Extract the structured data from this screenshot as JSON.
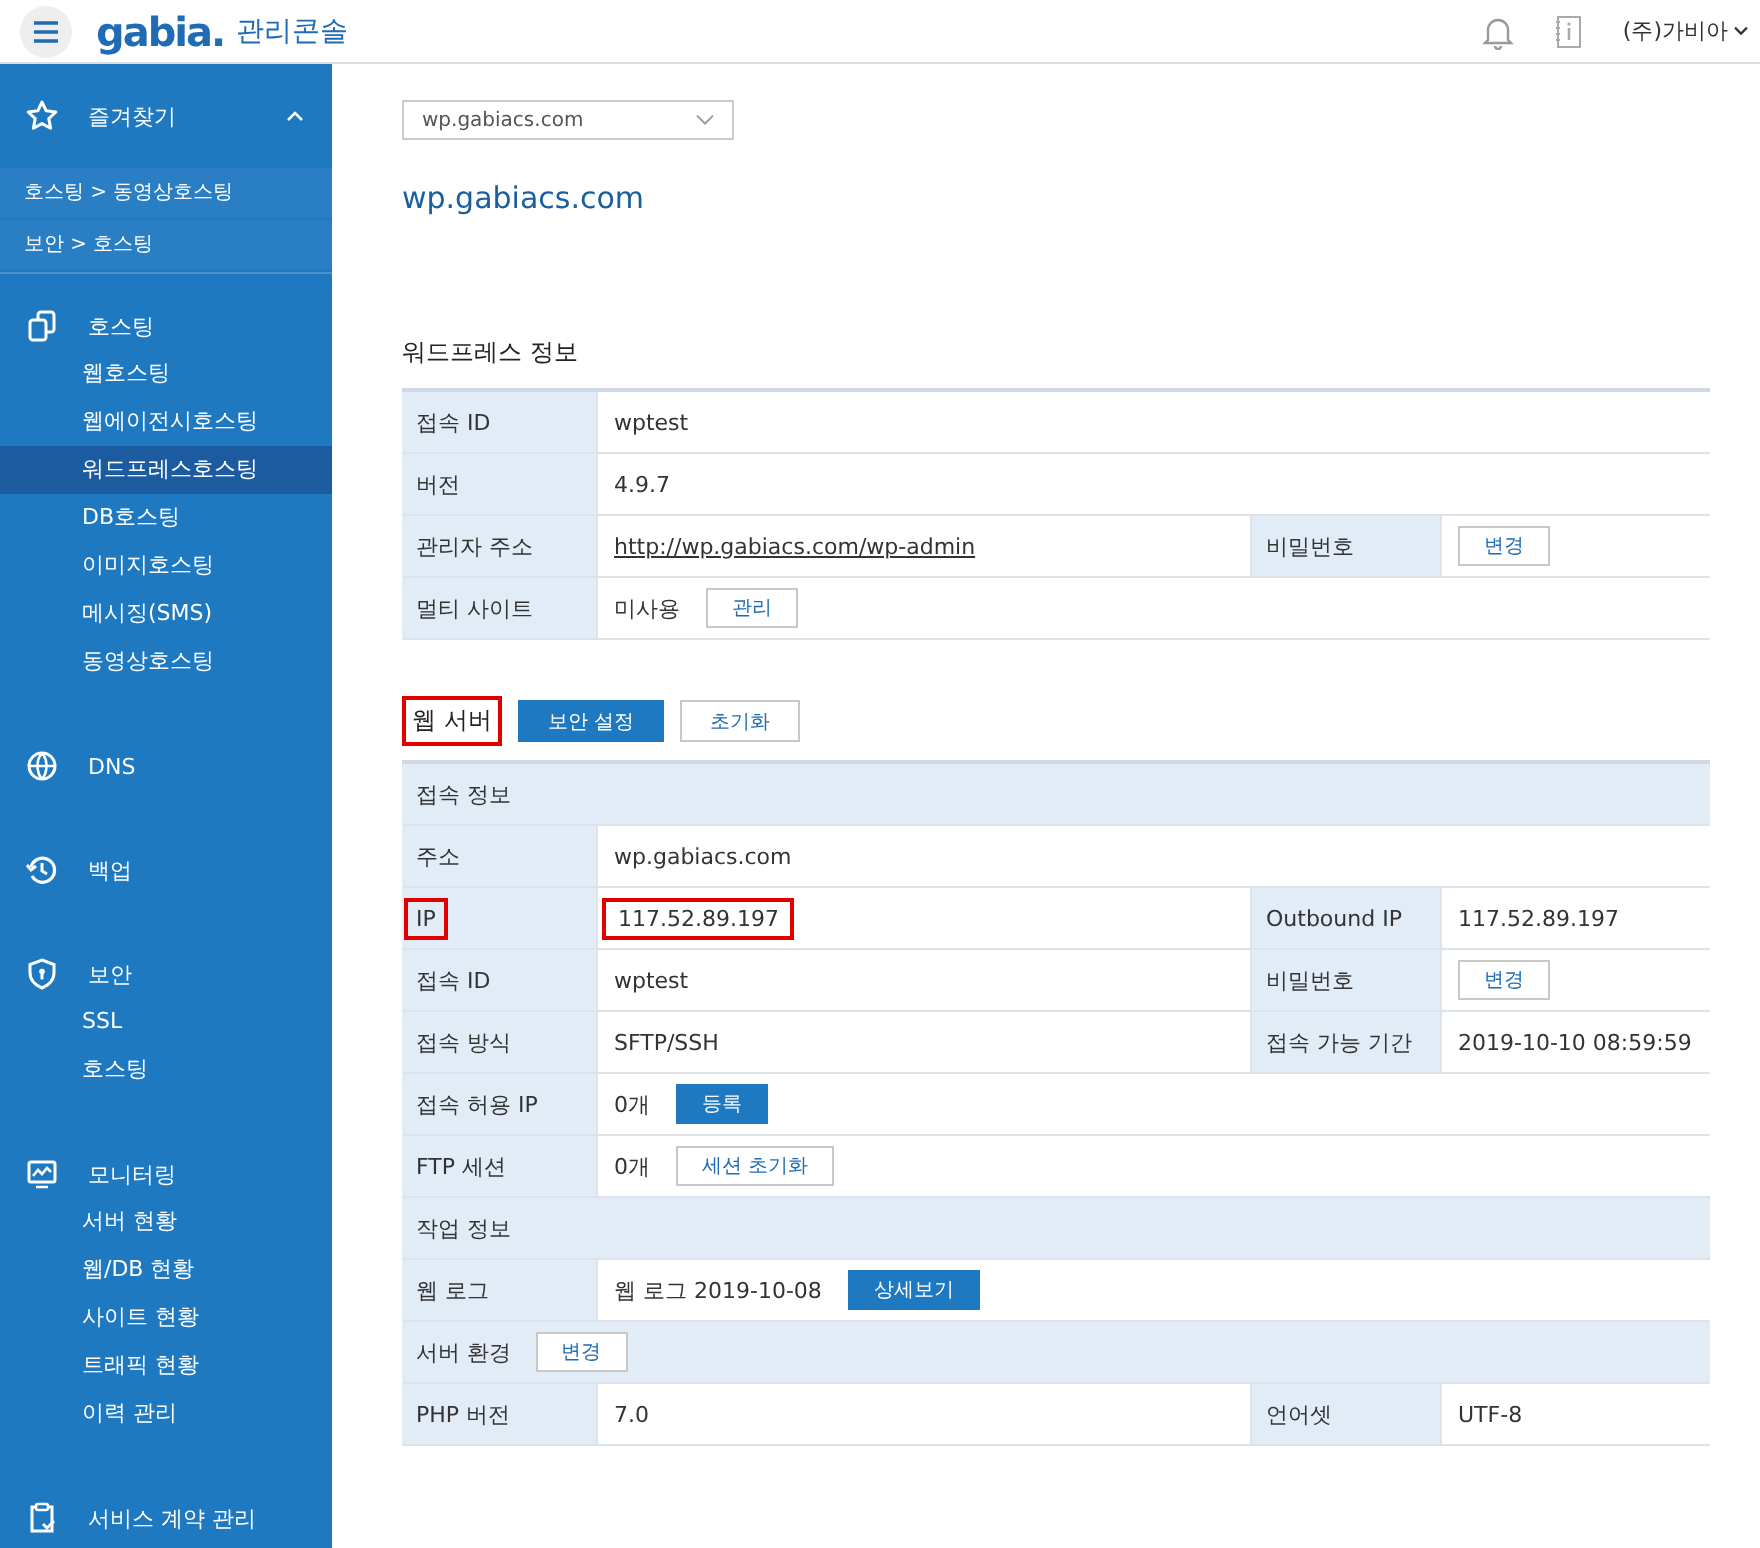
{
  "header": {
    "brand": "gabia.",
    "title": "관리콘솔",
    "account": "(주)가비아"
  },
  "favorites": {
    "label": "즐겨찾기",
    "expanded": true,
    "items": [
      "호스팅 > 동영상호스팅",
      "보안 > 호스팅"
    ]
  },
  "sidebar": [
    {
      "label": "호스팅",
      "children": [
        {
          "label": "웹호스팅",
          "selected": false
        },
        {
          "label": "웹에이전시호스팅",
          "selected": false
        },
        {
          "label": "워드프레스호스팅",
          "selected": true
        },
        {
          "label": "DB호스팅",
          "selected": false
        },
        {
          "label": "이미지호스팅",
          "selected": false
        },
        {
          "label": "메시징(SMS)",
          "selected": false
        },
        {
          "label": "동영상호스팅",
          "selected": false
        }
      ]
    },
    {
      "label": "DNS"
    },
    {
      "label": "백업"
    },
    {
      "label": "보안",
      "children": [
        {
          "label": "SSL",
          "selected": false
        },
        {
          "label": "호스팅",
          "selected": false
        }
      ]
    },
    {
      "label": "모니터링",
      "children": [
        {
          "label": "서버 현황",
          "selected": false
        },
        {
          "label": "웹/DB 현황",
          "selected": false
        },
        {
          "label": "사이트 현황",
          "selected": false
        },
        {
          "label": "트래픽 현황",
          "selected": false
        },
        {
          "label": "이력 관리",
          "selected": false
        }
      ]
    },
    {
      "label": "서비스 계약 관리"
    }
  ],
  "site_select": {
    "value": "wp.gabiacs.com"
  },
  "site_title": "wp.gabiacs.com",
  "sections": [
    {
      "title": "워드프레스 정보",
      "highlighted": false,
      "rows": [
        {
          "kind": "pair",
          "fields": [
            {
              "label": "접속 ID",
              "value": "wptest"
            }
          ]
        },
        {
          "kind": "pair",
          "fields": [
            {
              "label": "버전",
              "value": "4.9.7"
            }
          ]
        },
        {
          "kind": "pair",
          "fields": [
            {
              "label": "관리자 주소",
              "value": "http://wp.gabiacs.com/wp-admin",
              "link": true
            },
            {
              "label": "비밀번호",
              "buttons": [
                {
                  "label": "변경",
                  "kind": "outline"
                }
              ]
            }
          ]
        },
        {
          "kind": "pair",
          "fields": [
            {
              "label": "멀티 사이트",
              "value": "미사용",
              "buttons": [
                {
                  "label": "관리",
                  "kind": "outline"
                }
              ]
            }
          ]
        }
      ]
    },
    {
      "title": "웹 서버",
      "highlighted": true,
      "buttons": [
        {
          "label": "보안 설정",
          "kind": "primary"
        },
        {
          "label": "초기화",
          "kind": "outline"
        }
      ],
      "rows": [
        {
          "kind": "heading",
          "label": "접속 정보"
        },
        {
          "kind": "pair",
          "fields": [
            {
              "label": "주소",
              "value": "wp.gabiacs.com"
            }
          ]
        },
        {
          "kind": "pair",
          "fields": [
            {
              "label": "IP",
              "value": "117.52.89.197",
              "highlighted": true
            },
            {
              "label": "Outbound IP",
              "value": "117.52.89.197"
            }
          ]
        },
        {
          "kind": "pair",
          "fields": [
            {
              "label": "접속 ID",
              "value": "wptest"
            },
            {
              "label": "비밀번호",
              "buttons": [
                {
                  "label": "변경",
                  "kind": "outline"
                }
              ]
            }
          ]
        },
        {
          "kind": "pair",
          "fields": [
            {
              "label": "접속 방식",
              "value": "SFTP/SSH"
            },
            {
              "label": "접속 가능 기간",
              "value": "2019-10-10 08:59:59"
            }
          ]
        },
        {
          "kind": "pair",
          "fields": [
            {
              "label": "접속 허용 IP",
              "value": "0개",
              "buttons": [
                {
                  "label": "등록",
                  "kind": "primary"
                }
              ]
            }
          ]
        },
        {
          "kind": "pair",
          "fields": [
            {
              "label": "FTP 세션",
              "value": "0개",
              "buttons": [
                {
                  "label": "세션 초기화",
                  "kind": "outline"
                }
              ]
            }
          ]
        },
        {
          "kind": "heading",
          "label": "작업 정보"
        },
        {
          "kind": "pair",
          "fields": [
            {
              "label": "웹 로그",
              "value": "웹 로그 2019-10-08",
              "buttons": [
                {
                  "label": "상세보기",
                  "kind": "primary"
                }
              ]
            }
          ]
        },
        {
          "kind": "heading",
          "label": "서버 환경",
          "buttons": [
            {
              "label": "변경",
              "kind": "outline"
            }
          ]
        },
        {
          "kind": "pair",
          "fields": [
            {
              "label": "PHP 버전",
              "value": "7.0"
            },
            {
              "label": "언어셋",
              "value": "UTF-8"
            }
          ]
        }
      ]
    }
  ]
}
